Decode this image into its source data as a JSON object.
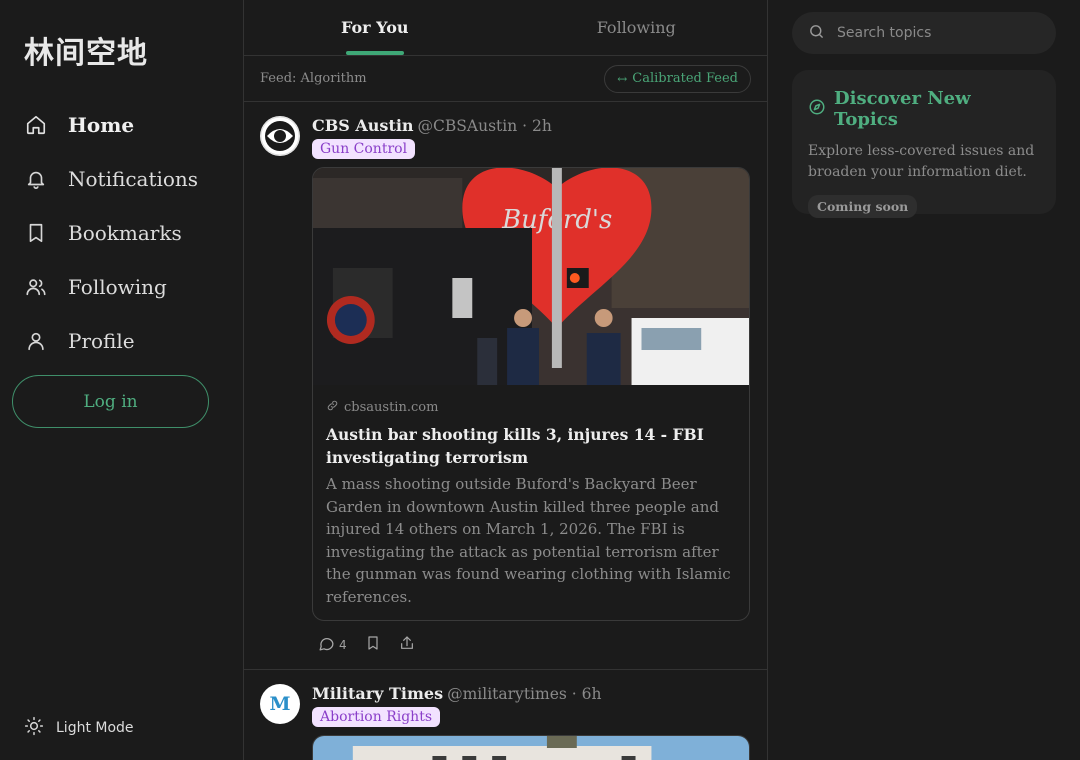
{
  "app": {
    "logo": "林间空地"
  },
  "sidebar": {
    "items": [
      {
        "label": "Home",
        "icon": "home-icon",
        "active": true
      },
      {
        "label": "Notifications",
        "icon": "bell-icon"
      },
      {
        "label": "Bookmarks",
        "icon": "bookmark-icon"
      },
      {
        "label": "Following",
        "icon": "users-icon"
      },
      {
        "label": "Profile",
        "icon": "user-icon"
      }
    ],
    "login_label": "Log in",
    "light_mode_label": "Light Mode"
  },
  "tabs": [
    {
      "label": "For You",
      "active": true
    },
    {
      "label": "Following",
      "active": false
    }
  ],
  "feedbar": {
    "feed_label": "Feed: Algorithm",
    "calibrated_label": "Calibrated Feed"
  },
  "posts": [
    {
      "author": "CBS Austin",
      "handle": "@CBSAustin · 2h",
      "tag": "Gun Control",
      "card": {
        "domain": "cbsaustin.com",
        "title": "Austin bar shooting kills 3, injures 14 - FBI investigating terrorism",
        "description": "A mass shooting outside Buford's Backyard Beer Garden in downtown Austin killed three people and injured 14 others on March 1, 2026. The FBI is investigating the attack as potential terrorism after the gunman was found wearing clothing with Islamic references."
      },
      "replies": "4"
    },
    {
      "author": "Military Times",
      "handle": "@militarytimes · 6h",
      "avatar_letter": "M",
      "tag": "Abortion Rights"
    }
  ],
  "right": {
    "search_placeholder": "Search topics",
    "discover": {
      "title": "Discover New Topics",
      "description": "Explore less-covered issues and broaden your information diet.",
      "badge": "Coming soon"
    }
  },
  "colors": {
    "accent": "#4fae80",
    "tag_bg": "#f2e2ff",
    "tag_fg": "#8a3fc9",
    "background": "#1b1b1b"
  }
}
